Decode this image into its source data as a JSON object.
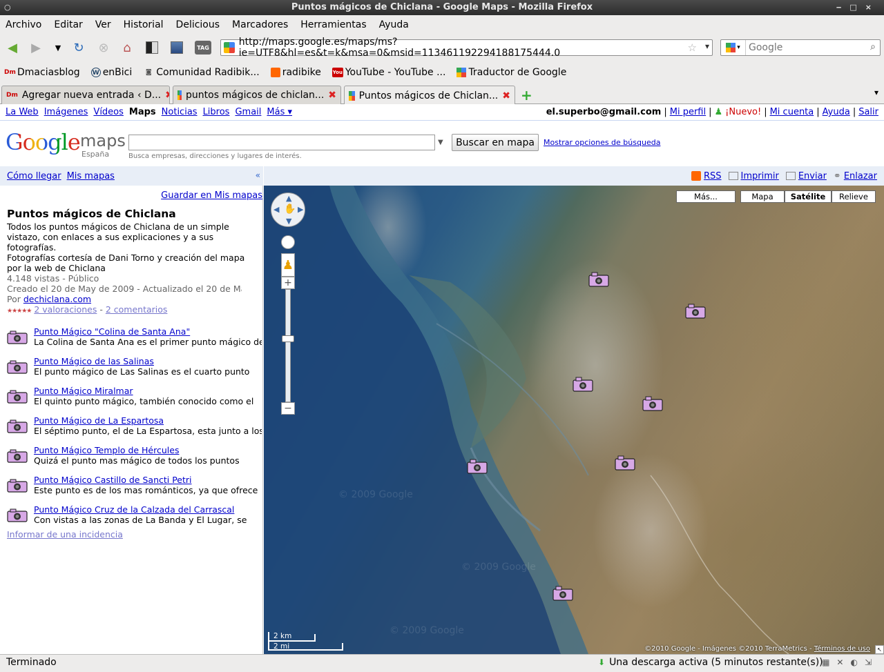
{
  "window": {
    "title": "Puntos mágicos de Chiclana - Google Maps - Mozilla Firefox"
  },
  "menu": [
    "Archivo",
    "Editar",
    "Ver",
    "Historial",
    "Delicious",
    "Marcadores",
    "Herramientas",
    "Ayuda"
  ],
  "navbar": {
    "url": "http://maps.google.es/maps/ms?ie=UTF8&hl=es&t=k&msa=0&msid=113461192294188175444.0",
    "search_placeholder": "Google",
    "tag_label": "TAG"
  },
  "bookmarks": [
    {
      "icon": "Dm",
      "label": "Dmaciasblog"
    },
    {
      "icon": "W",
      "label": "enBici"
    },
    {
      "icon": "◙",
      "label": "Comunidad Radibik..."
    },
    {
      "icon": "rss",
      "label": "radibike"
    },
    {
      "icon": "You",
      "label": "YouTube - YouTube ..."
    },
    {
      "icon": "g",
      "label": "Traductor de Google"
    }
  ],
  "tabs": [
    {
      "label": "Agregar nueva entrada ‹ D...",
      "active": false
    },
    {
      "label": "puntos mágicos de chiclan...",
      "active": false
    },
    {
      "label": "Puntos mágicos de Chiclan...",
      "active": true
    }
  ],
  "gbar": {
    "links": [
      "La Web",
      "Imágenes",
      "Vídeos",
      "Maps",
      "Noticias",
      "Libros",
      "Gmail",
      "Más ▾"
    ],
    "current": "Maps",
    "email": "el.superbo@gmail.com",
    "profile": "Mi perfil",
    "nuevo": "¡Nuevo!",
    "account": "Mi cuenta",
    "help": "Ayuda",
    "signout": "Salir"
  },
  "header": {
    "logo_google": "Google",
    "logo_maps": "maps",
    "logo_country": "España",
    "search_button": "Buscar en mapa",
    "search_options": "Mostrar opciones de búsqueda",
    "search_hint": "Busca empresas, direcciones y lugares de interés."
  },
  "leftbar": {
    "directions": "Cómo llegar",
    "mymaps": "Mis mapas",
    "collapse": "«"
  },
  "rightbar": {
    "rss": "RSS",
    "print": "Imprimir",
    "send": "Enviar",
    "link": "Enlazar"
  },
  "panel": {
    "save": "Guardar en Mis mapas",
    "title": "Puntos mágicos de Chiclana",
    "desc1": "Todos los puntos mágicos de Chiclana de un simple vistazo, con enlaces a sus explicaciones y a sus fotografías.",
    "desc2": "Fotografías cortesía de Dani Torno y creación del mapa por la web de Chiclana",
    "views": "4.148 vistas - Público",
    "created": "Creado el 20 de May de 2009 - Actualizado el 20 de May de",
    "by": "Por",
    "by_link": "dechiclana.com",
    "ratings": "2 valoraciones",
    "comments": "2 comentarios",
    "report": "Informar de una incidencia"
  },
  "places": [
    {
      "name": "Punto Mágico \"Colina de Santa Ana\"",
      "desc": "La Colina de Santa Ana es el primer punto mágico de"
    },
    {
      "name": "Punto Mágico de las Salinas",
      "desc": "El punto mágico de Las Salinas es el cuarto punto"
    },
    {
      "name": "Punto Mágico Miralmar",
      "desc": "El quinto punto mágico, también conocido como el"
    },
    {
      "name": "Punto Mágico de La Espartosa",
      "desc": "El séptimo punto, el de La Espartosa, esta junto a los"
    },
    {
      "name": "Punto Mágico Templo de Hércules",
      "desc": "Quizá el punto mas mágico de todos los puntos"
    },
    {
      "name": "Punto Mágico Castillo de Sancti Petri",
      "desc": "Este punto es de los mas románticos, ya que ofrece"
    },
    {
      "name": "Punto Mágico Cruz de la Calzada del Carrascal",
      "desc": "Con vistas a las zonas de La Banda y El Lugar, se"
    }
  ],
  "map": {
    "types": [
      "Más...",
      "Mapa",
      "Satélite",
      "Relieve"
    ],
    "selected_type": "Satélite",
    "scale_km": "2 km",
    "scale_mi": "2 mi",
    "copyright": "©2010 Google - Imágenes ©2010 TerraMetrics -",
    "terms": "Términos de uso",
    "watermark": "© 2009 Google"
  },
  "status": {
    "left": "Terminado",
    "download": "Una descarga activa (5 minutos restante(s))"
  }
}
